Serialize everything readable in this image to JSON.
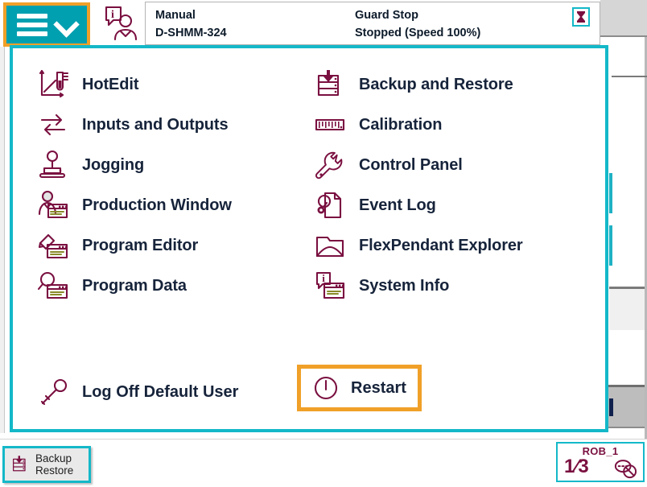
{
  "app": {
    "name": "ABB FlexPendant",
    "accent_teal": "#14b8c8",
    "accent_orange": "#f0a028",
    "icon_maroon": "#7a1040",
    "menu_button_bg": "#00a0b0"
  },
  "statusbar": {
    "menu_button_name": "main-menu",
    "operator_icon": "operator-info-icon",
    "mode_label": "Manual",
    "controller_name": "D-SHMM-324",
    "guard_state": "Guard Stop",
    "run_state": "Stopped (Speed 100%)",
    "stopwatch_icon": "stopwatch-icon"
  },
  "menu": {
    "left_column": [
      {
        "label": "HotEdit",
        "icon": "hotedit-icon"
      },
      {
        "label": "Inputs and Outputs",
        "icon": "inputs-outputs-icon"
      },
      {
        "label": "Jogging",
        "icon": "joystick-icon"
      },
      {
        "label": "Production Window",
        "icon": "production-window-icon"
      },
      {
        "label": "Program Editor",
        "icon": "program-editor-icon"
      },
      {
        "label": "Program Data",
        "icon": "program-data-icon"
      }
    ],
    "right_column": [
      {
        "label": "Backup and Restore",
        "icon": "backup-restore-icon"
      },
      {
        "label": "Calibration",
        "icon": "calibration-ruler-icon"
      },
      {
        "label": "Control Panel",
        "icon": "wrench-icon"
      },
      {
        "label": "Event Log",
        "icon": "event-log-icon"
      },
      {
        "label": "FlexPendant Explorer",
        "icon": "folder-icon"
      },
      {
        "label": "System Info",
        "icon": "system-info-icon"
      }
    ],
    "logoff": {
      "label": "Log Off Default User",
      "icon": "key-icon"
    },
    "restart": {
      "label": "Restart",
      "icon": "power-icon",
      "focused": true
    }
  },
  "taskbar": {
    "task_button": {
      "line1": "Backup",
      "line2": "Restore",
      "icon": "backup-restore-icon"
    },
    "quickset": {
      "title": "ROB_1",
      "numerator": "1",
      "denominator": "3",
      "icon": "quickset-no-motion-icon"
    }
  }
}
